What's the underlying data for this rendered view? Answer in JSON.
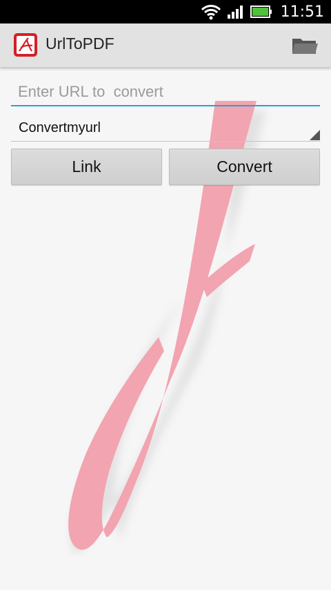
{
  "status_bar": {
    "time": "11:51",
    "icons": [
      "wifi-icon",
      "signal-icon",
      "battery-icon"
    ]
  },
  "action_bar": {
    "title": "UrlToPDF",
    "app_icon": "pdf-app-icon",
    "action_icon": "folder-icon"
  },
  "form": {
    "url_placeholder": "Enter URL to  convert",
    "url_value": "",
    "service_selected": "Convertmyurl"
  },
  "buttons": {
    "link_label": "Link",
    "convert_label": "Convert"
  },
  "colors": {
    "accent": "#2b9fd4",
    "watermark": "#f2a4b0",
    "brand_red": "#d32027"
  }
}
